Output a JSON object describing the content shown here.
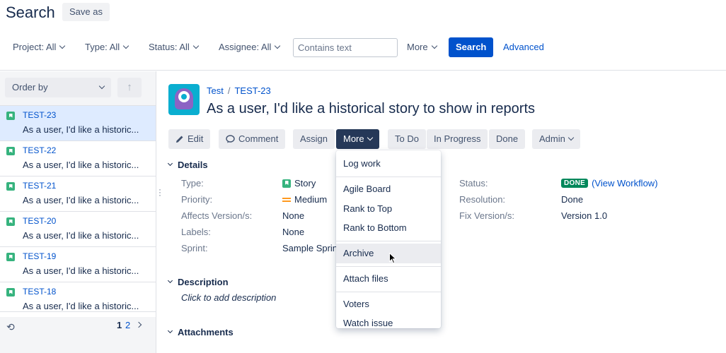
{
  "header": {
    "title": "Search",
    "save_as": "Save as"
  },
  "filters": {
    "project": "Project: All",
    "type": "Type: All",
    "status": "Status: All",
    "assignee": "Assignee: All",
    "text_placeholder": "Contains text",
    "more": "More",
    "search": "Search",
    "advanced": "Advanced"
  },
  "list": {
    "order_by": "Order by",
    "items": [
      {
        "key": "TEST-23",
        "summary": "As a user, I'd like a historic..."
      },
      {
        "key": "TEST-22",
        "summary": "As a user, I'd like a historic..."
      },
      {
        "key": "TEST-21",
        "summary": "As a user, I'd like a historic..."
      },
      {
        "key": "TEST-20",
        "summary": "As a user, I'd like a historic..."
      },
      {
        "key": "TEST-19",
        "summary": "As a user, I'd like a historic..."
      },
      {
        "key": "TEST-18",
        "summary": "As a user, I'd like a historic..."
      }
    ],
    "pages": [
      "1",
      "2"
    ]
  },
  "issue": {
    "project": "Test",
    "key": "TEST-23",
    "title": "As a user, I'd like a historical story to show in reports",
    "toolbar": {
      "edit": "Edit",
      "comment": "Comment",
      "assign": "Assign",
      "more": "More",
      "todo": "To Do",
      "in_progress": "In Progress",
      "done": "Done",
      "admin": "Admin"
    },
    "details": {
      "heading": "Details",
      "type_label": "Type:",
      "type_value": "Story",
      "priority_label": "Priority:",
      "priority_value": "Medium",
      "affects_label": "Affects Version/s:",
      "affects_value": "None",
      "labels_label": "Labels:",
      "labels_value": "None",
      "sprint_label": "Sprint:",
      "sprint_value": "Sample Sprin",
      "status_label": "Status:",
      "status_badge": "DONE",
      "view_workflow": "(View Workflow)",
      "resolution_label": "Resolution:",
      "resolution_value": "Done",
      "fix_label": "Fix Version/s:",
      "fix_value": "Version 1.0"
    },
    "description": {
      "heading": "Description",
      "placeholder": "Click to add description"
    },
    "attachments": {
      "heading": "Attachments"
    }
  },
  "more_menu": [
    "Log work",
    "Agile Board",
    "Rank to Top",
    "Rank to Bottom",
    "Archive",
    "Attach files",
    "Voters",
    "Watch issue"
  ],
  "colors": {
    "primary": "#0052cc",
    "more_active": "#253858",
    "done_badge": "#00875a",
    "story": "#36b37e"
  }
}
